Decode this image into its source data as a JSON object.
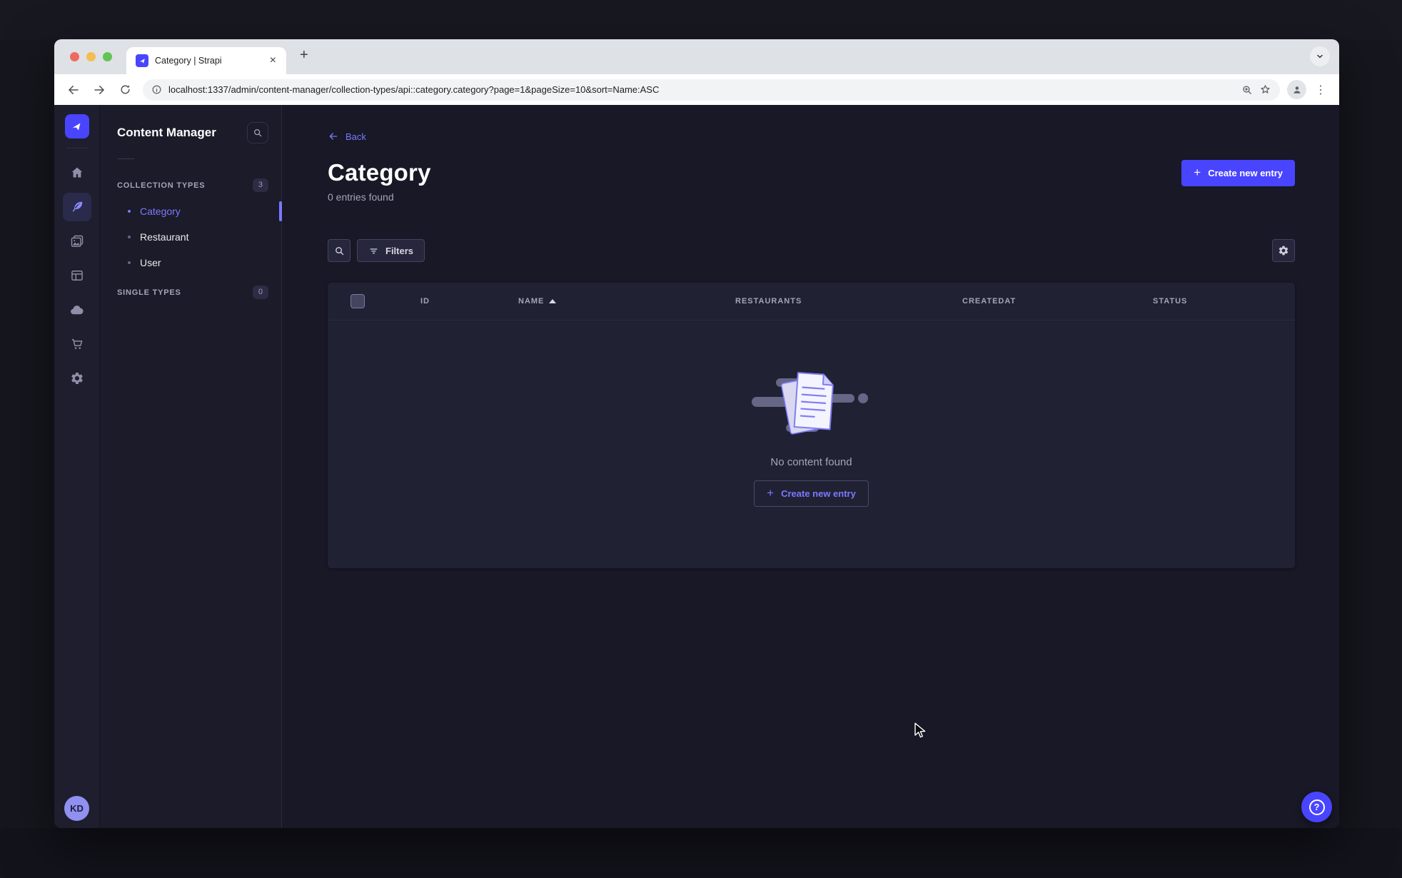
{
  "browser": {
    "tab_title": "Category | Strapi",
    "url": "localhost:1337/admin/content-manager/collection-types/api::category.category?page=1&pageSize=10&sort=Name:ASC",
    "new_tab_glyph": "+",
    "close_tab_glyph": "×",
    "menu_glyph": "⋮"
  },
  "rail": {
    "avatar_initials": "KD"
  },
  "panel": {
    "title": "Content Manager",
    "collection_types_label": "COLLECTION TYPES",
    "collection_types_count": "3",
    "items": [
      {
        "label": "Category",
        "active": true
      },
      {
        "label": "Restaurant",
        "active": false
      },
      {
        "label": "User",
        "active": false
      }
    ],
    "single_types_label": "SINGLE TYPES",
    "single_types_count": "0"
  },
  "main": {
    "back_label": "Back",
    "title": "Category",
    "entries_found": "0 entries found",
    "create_entry_label": "Create new entry",
    "filters_label": "Filters",
    "plus_glyph": "+",
    "table": {
      "columns": [
        "ID",
        "NAME",
        "RESTAURANTS",
        "CREATEDAT",
        "STATUS"
      ],
      "sorted_by": "NAME",
      "sort_direction": "ascending"
    },
    "empty_state": {
      "message": "No content found",
      "create_entry_label": "Create new entry"
    }
  },
  "help": {
    "question_glyph": "?"
  },
  "colors": {
    "accent": "#4945ff",
    "link": "#7b79ff",
    "app_background": "#181826",
    "card_background": "#212134",
    "muted_text": "#a5a5ba"
  }
}
